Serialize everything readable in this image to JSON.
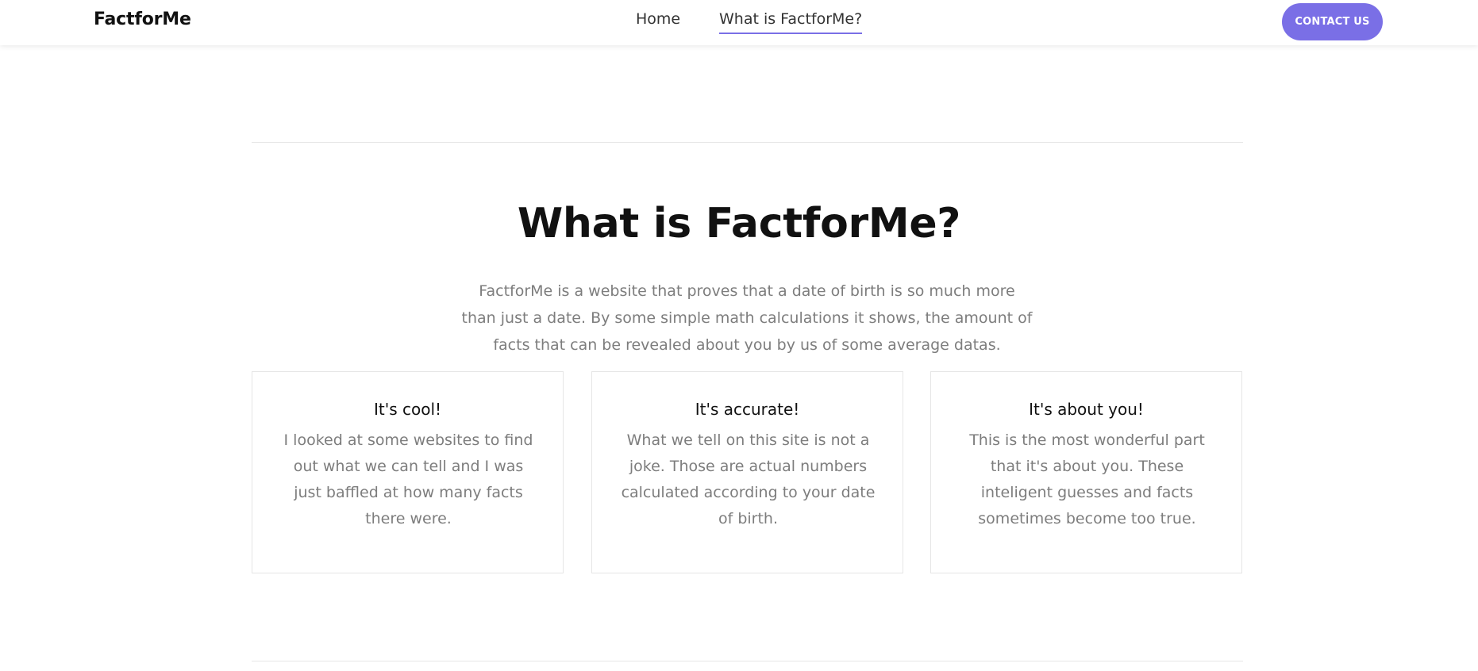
{
  "navbar": {
    "brand": "FactforMe",
    "links": [
      {
        "label": "Home",
        "active": false
      },
      {
        "label": "What is FactforMe?",
        "active": true
      }
    ],
    "contact_label": "CONTACT US"
  },
  "main": {
    "heading": "What is FactforMe?",
    "intro": "FactforMe is a website that proves that a date of birth is so much more than just a date. By some simple math calculations it shows, the amount of facts that can be revealed about you by us of some average datas.",
    "cards": [
      {
        "title": "It's cool!",
        "text": "I looked at some websites to find out what we can tell and I was just baffled at how many facts there were."
      },
      {
        "title": "It's accurate!",
        "text": "What we tell on this site is not a joke. Those are actual numbers calculated according to your date of birth."
      },
      {
        "title": "It's about you!",
        "text": "This is the most wonderful part that it's about you. These inteligent guesses and facts sometimes become too true."
      }
    ]
  },
  "colors": {
    "accent": "#7a6fe6",
    "muted_text": "#7d7d7d",
    "border": "#e6e6e6"
  }
}
